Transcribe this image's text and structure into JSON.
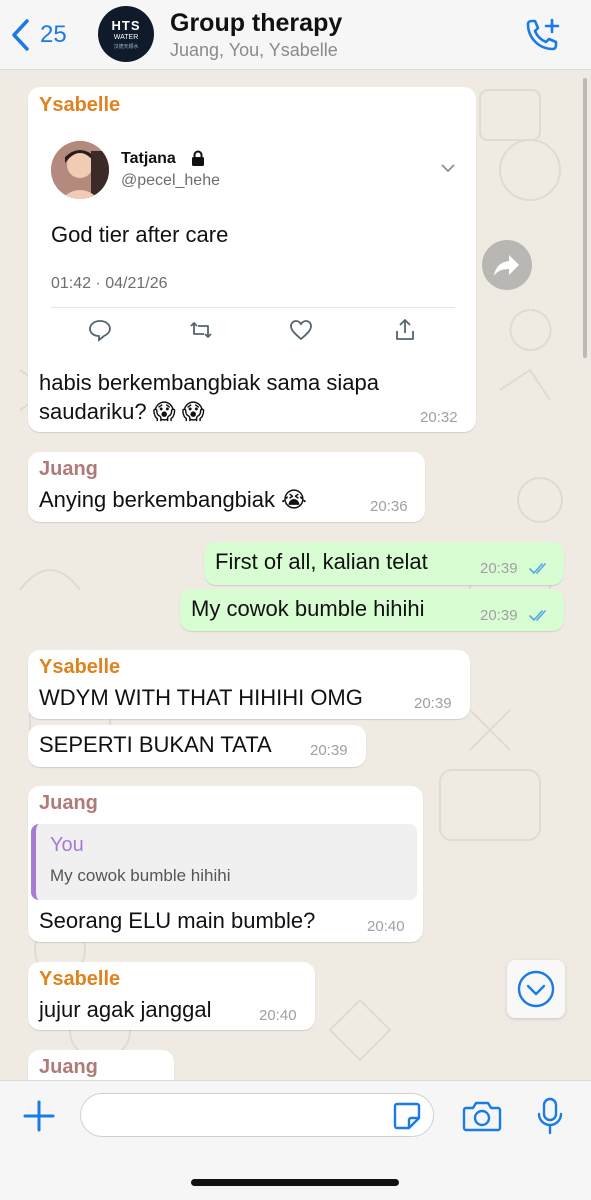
{
  "header": {
    "back_count": "25",
    "avatar_line1": "HTS",
    "avatar_line2": "WATER",
    "avatar_line3": "汉德天顺水",
    "title": "Group therapy",
    "subtitle": "Juang, You, Ysabelle",
    "icons": {
      "back": "chevron-left-icon",
      "call": "add-call-icon"
    }
  },
  "colors": {
    "accent": "#1a7be6",
    "ysabelle": "#e0821e",
    "juang": "#b07a78",
    "you_quote": "#a67bd6",
    "outgoing_bubble": "#d9fdd3",
    "read_ticks": "#4fa8e8"
  },
  "messages": {
    "m1": {
      "sender": "Ysabelle",
      "tweet": {
        "name": "Tatjana",
        "handle": "@pecel_hehe",
        "text": "God tier after care",
        "date": "01:42 · 04/21/26"
      },
      "line1": "habis berkembangbiak sama siapa",
      "line2": "saudariku? 😱 😱",
      "time": "20:32"
    },
    "m2": {
      "sender": "Juang",
      "text": "Anying berkembangbiak 😭",
      "time": "20:36"
    },
    "m3": {
      "text": "First of all, kalian telat",
      "time": "20:39"
    },
    "m4": {
      "text": "My cowok bumble hihihi",
      "time": "20:39"
    },
    "m5": {
      "sender": "Ysabelle",
      "text": "WDYM WITH THAT HIHIHI OMG",
      "time": "20:39"
    },
    "m6": {
      "text": "SEPERTI BUKAN TATA",
      "time": "20:39"
    },
    "m7": {
      "sender": "Juang",
      "quote_name": "You",
      "quote_text": "My cowok bumble hihihi",
      "text": "Seorang ELU main bumble?",
      "time": "20:40"
    },
    "m8": {
      "sender": "Ysabelle",
      "text": "jujur agak janggal",
      "time": "20:40"
    },
    "m9": {
      "sender": "Juang"
    }
  },
  "composer": {
    "placeholder": "",
    "icons": {
      "plus": "plus-icon",
      "sticker": "sticker-icon",
      "camera": "camera-icon",
      "mic": "microphone-icon"
    }
  }
}
